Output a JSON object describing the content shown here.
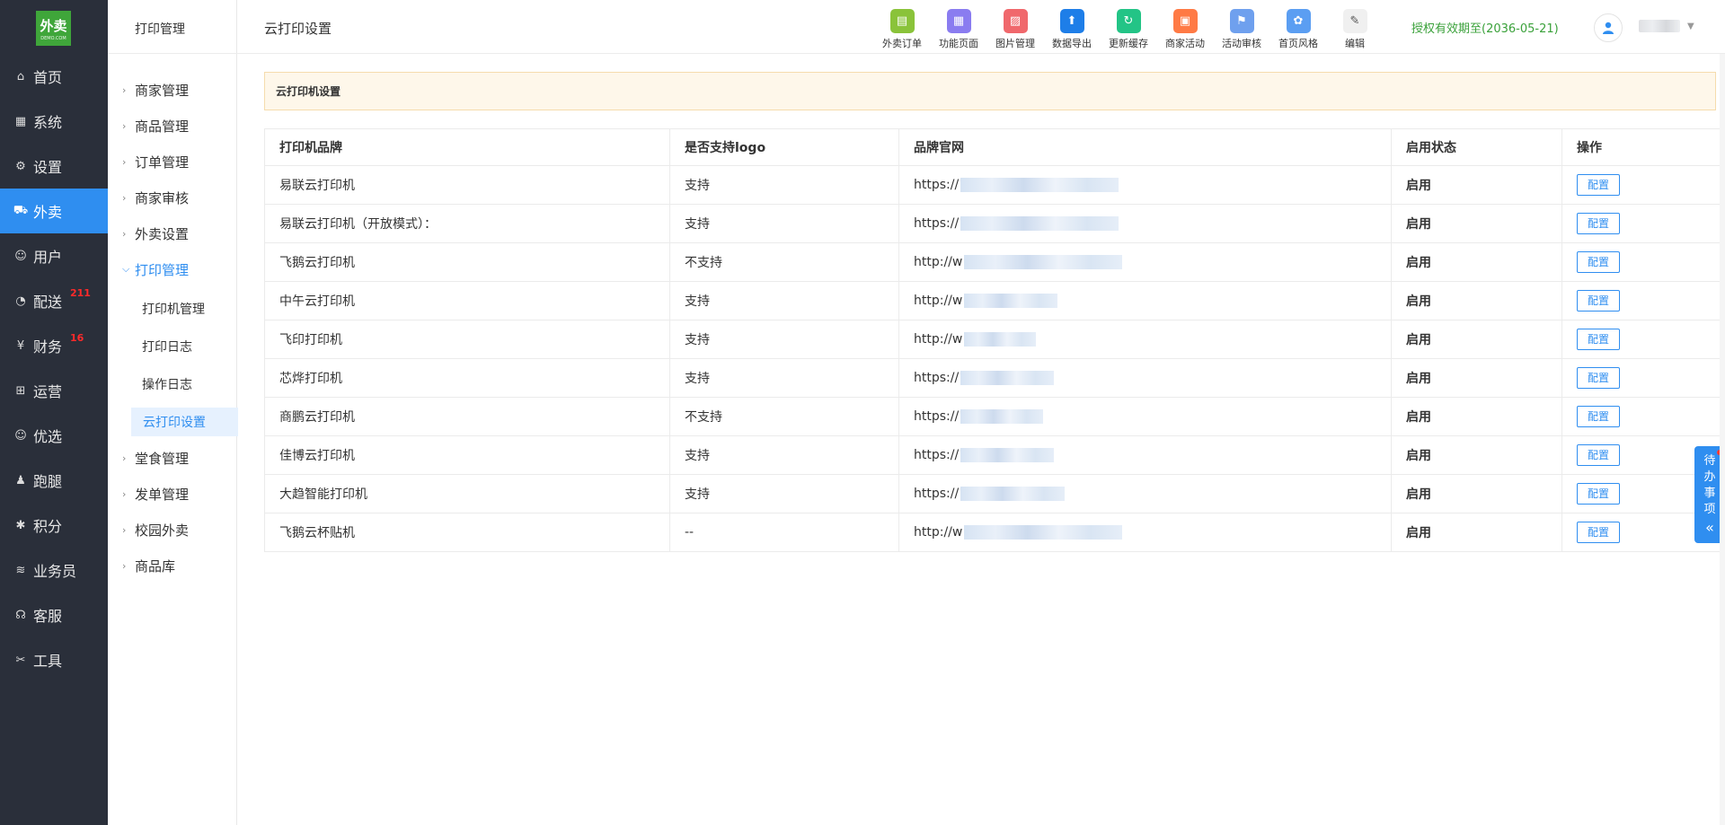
{
  "logo": {
    "text": "外卖",
    "sub": "DEMO.COM"
  },
  "sidebar": {
    "items": [
      {
        "label": "首页",
        "icon": "home-icon",
        "glyph": "⌂"
      },
      {
        "label": "系统",
        "icon": "windows-icon",
        "glyph": "▦"
      },
      {
        "label": "设置",
        "icon": "gear-icon",
        "glyph": "⚙"
      },
      {
        "label": "外卖",
        "icon": "cart-icon",
        "glyph": "⛟",
        "active": true
      },
      {
        "label": "用户",
        "icon": "user-icon",
        "glyph": "☺"
      },
      {
        "label": "配送",
        "icon": "dashboard-icon",
        "glyph": "◔",
        "badge": "211"
      },
      {
        "label": "财务",
        "icon": "yen-icon",
        "glyph": "¥",
        "badge": "16"
      },
      {
        "label": "运营",
        "icon": "gift-icon",
        "glyph": "⊞"
      },
      {
        "label": "优选",
        "icon": "smile-icon",
        "glyph": "☺"
      },
      {
        "label": "跑腿",
        "icon": "person-icon",
        "glyph": "♟"
      },
      {
        "label": "积分",
        "icon": "points-icon",
        "glyph": "✱"
      },
      {
        "label": "业务员",
        "icon": "layers-icon",
        "glyph": "≋"
      },
      {
        "label": "客服",
        "icon": "headset-icon",
        "glyph": "☊"
      },
      {
        "label": "工具",
        "icon": "tools-icon",
        "glyph": "✂"
      }
    ]
  },
  "subnav": {
    "title": "打印管理",
    "groups": [
      {
        "label": "商家管理"
      },
      {
        "label": "商品管理"
      },
      {
        "label": "订单管理"
      },
      {
        "label": "商家审核"
      },
      {
        "label": "外卖设置"
      },
      {
        "label": "打印管理",
        "open": true
      },
      {
        "label": "堂食管理"
      },
      {
        "label": "发单管理"
      },
      {
        "label": "校园外卖"
      },
      {
        "label": "商品库"
      }
    ],
    "children": [
      {
        "label": "打印机管理"
      },
      {
        "label": "打印日志"
      },
      {
        "label": "操作日志"
      },
      {
        "label": "云打印设置",
        "active": true
      }
    ]
  },
  "header": {
    "title": "云打印设置",
    "tools": [
      {
        "label": "外卖订单",
        "icon": "receipt-icon",
        "color": "#8ac33a",
        "glyph": "▤"
      },
      {
        "label": "功能页面",
        "icon": "grid-icon",
        "color": "#8a7cf0",
        "glyph": "▦"
      },
      {
        "label": "图片管理",
        "icon": "image-icon",
        "color": "#f0686c",
        "glyph": "▨"
      },
      {
        "label": "数据导出",
        "icon": "upload-icon",
        "color": "#1e7ee8",
        "glyph": "⬆"
      },
      {
        "label": "更新缓存",
        "icon": "refresh-icon",
        "color": "#23c486",
        "glyph": "↻"
      },
      {
        "label": "商家活动",
        "icon": "gift-icon",
        "color": "#ff7a45",
        "glyph": "▣"
      },
      {
        "label": "活动审核",
        "icon": "flag-icon",
        "color": "#6fa0ee",
        "glyph": "⚑"
      },
      {
        "label": "首页风格",
        "icon": "palette-icon",
        "color": "#5b9ef2",
        "glyph": "✿"
      },
      {
        "label": "编辑",
        "icon": "pen-icon",
        "color": "#f0f0f0",
        "glyph": "✎"
      }
    ],
    "license": "授权有效期至(2036-05-21)"
  },
  "notice": "云打印机设置",
  "table": {
    "columns": [
      "打印机品牌",
      "是否支持logo",
      "品牌官网",
      "启用状态",
      "操作"
    ],
    "rows": [
      {
        "brand": "易联云打印机",
        "logo": "支持",
        "site": "https://",
        "status": "启用",
        "action": "配置"
      },
      {
        "brand": "易联云打印机（开放模式）：",
        "logo": "支持",
        "site": "https://",
        "status": "启用",
        "action": "配置"
      },
      {
        "brand": "飞鹅云打印机",
        "logo": "不支持",
        "site": "http://w",
        "status": "启用",
        "action": "配置"
      },
      {
        "brand": "中午云打印机",
        "logo": "支持",
        "site": "http://w",
        "status": "启用",
        "action": "配置"
      },
      {
        "brand": "飞印打印机",
        "logo": "支持",
        "site": "http://w",
        "status": "启用",
        "action": "配置"
      },
      {
        "brand": "芯烨打印机",
        "logo": "支持",
        "site": "https://",
        "status": "启用",
        "action": "配置"
      },
      {
        "brand": "商鹏云打印机",
        "logo": "不支持",
        "site": "https://",
        "status": "启用",
        "action": "配置"
      },
      {
        "brand": "佳博云打印机",
        "logo": "支持",
        "site": "https://",
        "status": "启用",
        "action": "配置"
      },
      {
        "brand": "大趋智能打印机",
        "logo": "支持",
        "site": "https://",
        "status": "启用",
        "action": "配置"
      },
      {
        "brand": "飞鹅云杯贴机",
        "logo": "--",
        "site": "http://w",
        "status": "启用",
        "action": "配置"
      }
    ]
  },
  "todo": {
    "label": "待办事项",
    "arrow": "«"
  }
}
